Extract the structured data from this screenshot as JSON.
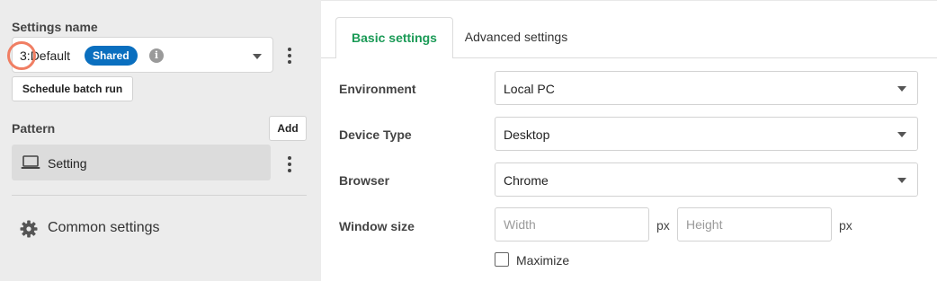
{
  "sidebar": {
    "settings_name_label": "Settings name",
    "selected_setting": {
      "number": "3:",
      "name": "Default",
      "badge": "Shared",
      "info_icon": "i"
    },
    "schedule_button": "Schedule batch run",
    "pattern_label": "Pattern",
    "add_button": "Add",
    "pattern_items": [
      {
        "label": "Setting",
        "icon": "laptop-icon"
      }
    ],
    "common_settings": "Common settings"
  },
  "tabs": [
    {
      "label": "Basic settings",
      "active": true
    },
    {
      "label": "Advanced settings",
      "active": false
    }
  ],
  "form": {
    "environment": {
      "label": "Environment",
      "value": "Local PC"
    },
    "device_type": {
      "label": "Device Type",
      "value": "Desktop"
    },
    "browser": {
      "label": "Browser",
      "value": "Chrome"
    },
    "window_size": {
      "label": "Window size",
      "width_placeholder": "Width",
      "height_placeholder": "Height",
      "unit": "px",
      "maximize_label": "Maximize",
      "maximize_checked": false
    }
  },
  "colors": {
    "accent_green": "#1a9a56",
    "badge_blue": "#0a6fbf",
    "highlight_ring": "#f07e63",
    "sidebar_bg": "#ececec"
  }
}
